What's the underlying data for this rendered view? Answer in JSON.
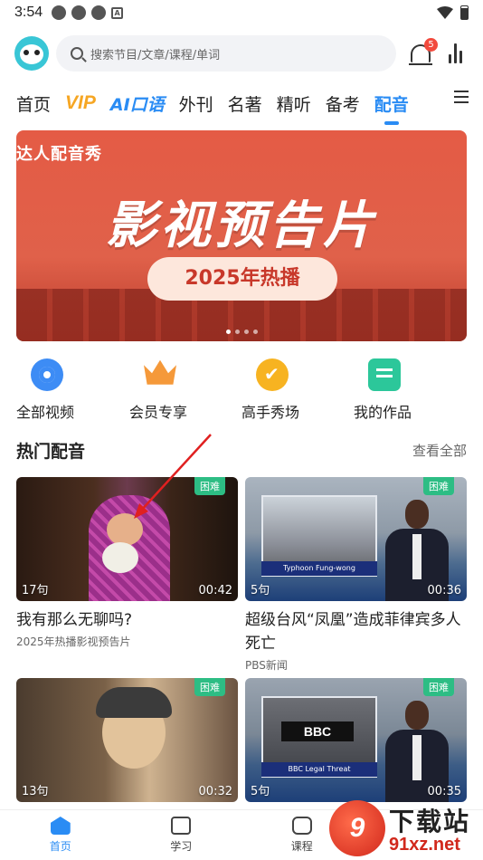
{
  "status_bar": {
    "time": "3:54"
  },
  "header": {
    "search_placeholder": "搜索节目/文章/课程/单词",
    "notification_count": "5"
  },
  "tabs": [
    "首页",
    "VIP",
    "AI口语",
    "外刊",
    "名著",
    "精听",
    "备考",
    "配音"
  ],
  "active_tab": "配音",
  "banner": {
    "tag": "达人配音秀",
    "title": "影视预告片",
    "pill": "2025年热播",
    "dots": 4,
    "active_dot": 0
  },
  "quick_entries": [
    {
      "label": "全部视频",
      "icon": "video-icon"
    },
    {
      "label": "会员专享",
      "icon": "crown-icon"
    },
    {
      "label": "高手秀场",
      "icon": "thumbs-up-icon"
    },
    {
      "label": "我的作品",
      "icon": "works-icon"
    }
  ],
  "section": {
    "title": "热门配音",
    "more": "查看全部"
  },
  "videos": [
    {
      "badge": "困难",
      "count": "17句",
      "duration": "00:42",
      "title": "我有那么无聊吗?",
      "subtitle": "2025年热播影视预告片"
    },
    {
      "badge": "困难",
      "count": "5句",
      "duration": "00:36",
      "title": "超级台风“凤凰”造成菲律宾多人死亡",
      "subtitle": "PBS新闻",
      "overlay": "Typhoon Fung-wong"
    },
    {
      "badge": "困难",
      "count": "13句",
      "duration": "00:32",
      "title": "",
      "subtitle": ""
    },
    {
      "badge": "困难",
      "count": "5句",
      "duration": "00:35",
      "title": "",
      "subtitle": "",
      "overlay": "BBC Legal Threat"
    }
  ],
  "bottom_nav": [
    {
      "label": "首页",
      "icon": "home-icon"
    },
    {
      "label": "学习",
      "icon": "tv-icon"
    },
    {
      "label": "课程",
      "icon": "course-icon"
    },
    {
      "label": "",
      "icon": "profile-icon"
    }
  ],
  "watermark": {
    "badge": "9",
    "text": "下载站",
    "url": "91xz.net"
  },
  "colors": {
    "accent": "#2a8cf4",
    "vip": "#f6a623",
    "difficulty": "#2dbd84",
    "badge_red": "#f24a3d"
  }
}
